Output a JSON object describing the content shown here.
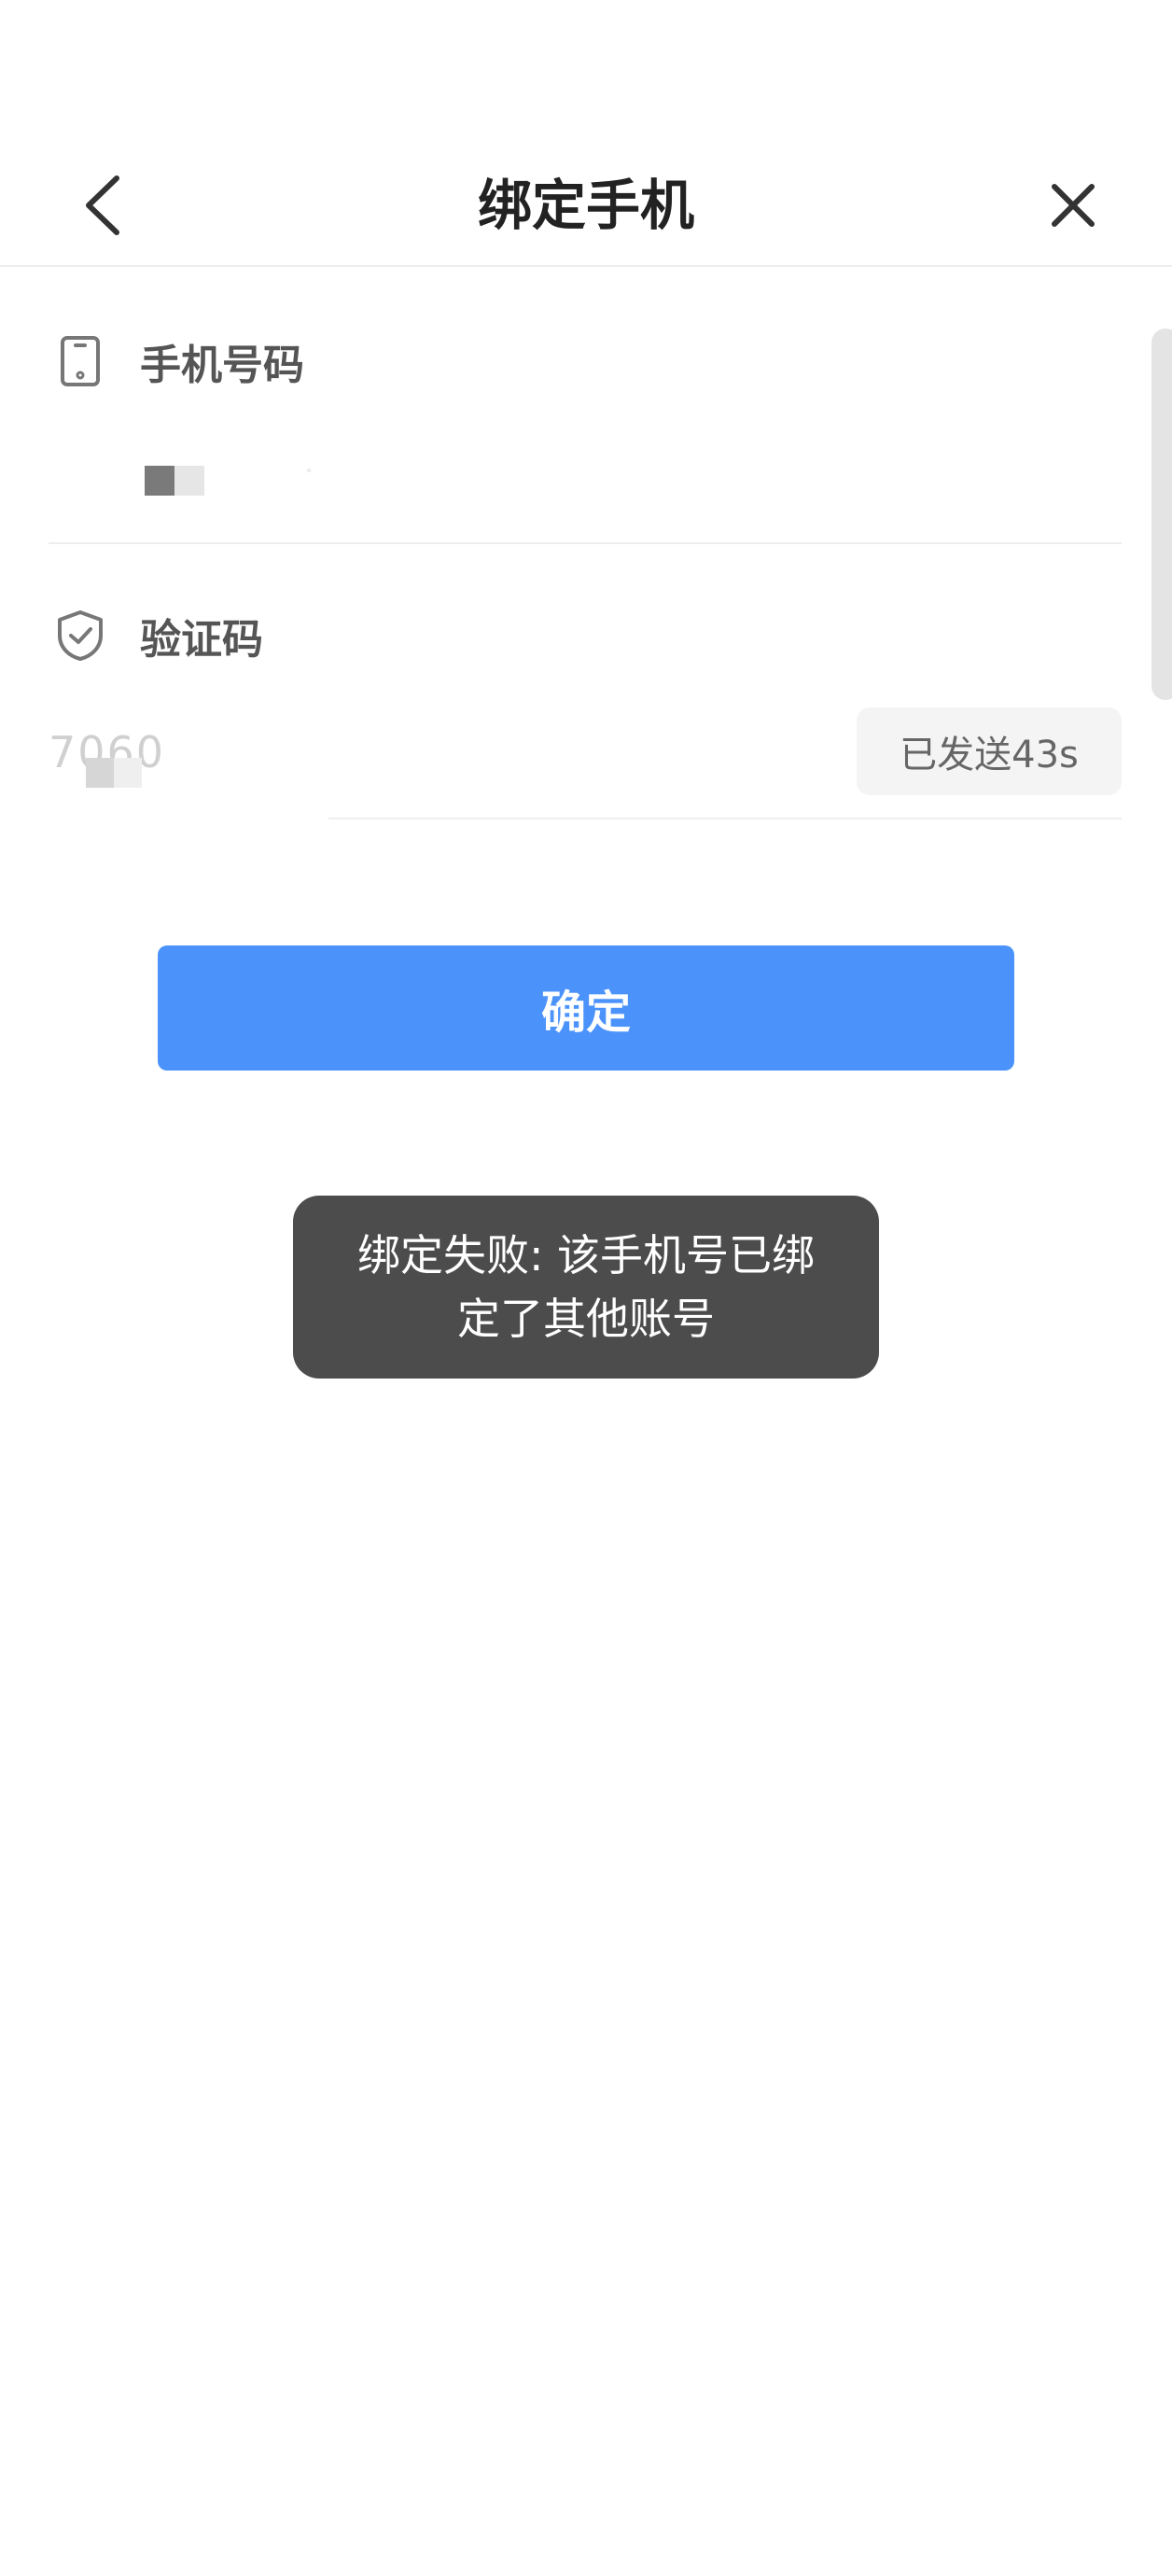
{
  "header": {
    "title": "绑定手机",
    "back_icon": "chevron-left-icon",
    "close_icon": "close-icon"
  },
  "phone_section": {
    "label": "手机号码",
    "icon": "phone-icon"
  },
  "code_section": {
    "label": "验证码",
    "icon": "shield-check-icon",
    "value": "7060",
    "resend_label": "已发送43s"
  },
  "confirm_label": "确定",
  "toast_message": "绑定失败: 该手机号已绑定了其他账号",
  "colors": {
    "primary": "#4b93fb",
    "toast_bg": "#4c4c4c"
  }
}
